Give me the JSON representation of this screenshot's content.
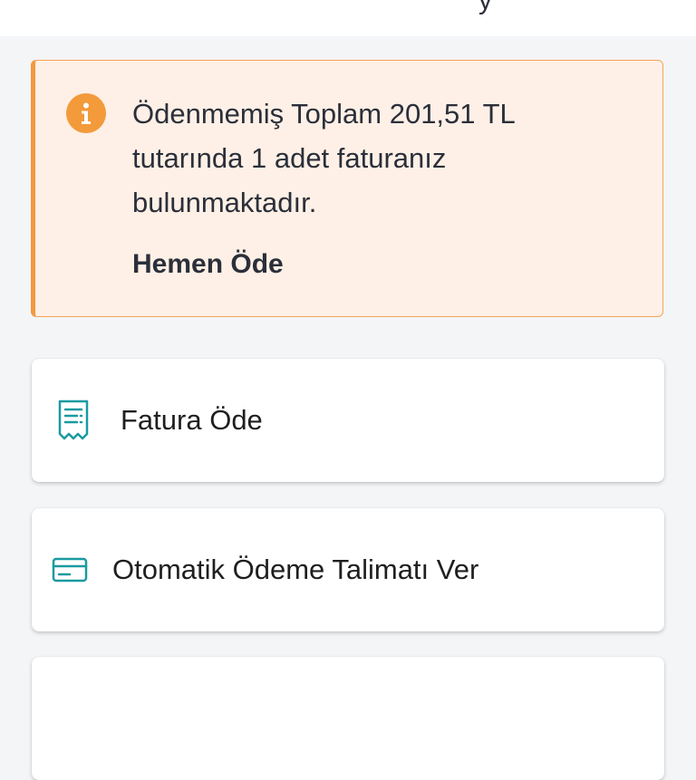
{
  "top_bar": {
    "glyph": "y"
  },
  "alert": {
    "icon": "info-icon",
    "message": "Ödenmemiş Toplam 201,51 TL tutarında 1 adet faturanız bulunmaktadır.",
    "action_label": "Hemen Öde",
    "colors": {
      "background": "#fef0e6",
      "border": "#f29a3e",
      "icon": "#f39a3a"
    }
  },
  "menu": {
    "items": [
      {
        "icon": "receipt-icon",
        "label": "Fatura Öde"
      },
      {
        "icon": "credit-card-icon",
        "label": "Otomatik Ödeme Talimatı Ver"
      },
      {
        "icon": "",
        "label": ""
      }
    ],
    "icon_color": "#1a9aa0"
  }
}
